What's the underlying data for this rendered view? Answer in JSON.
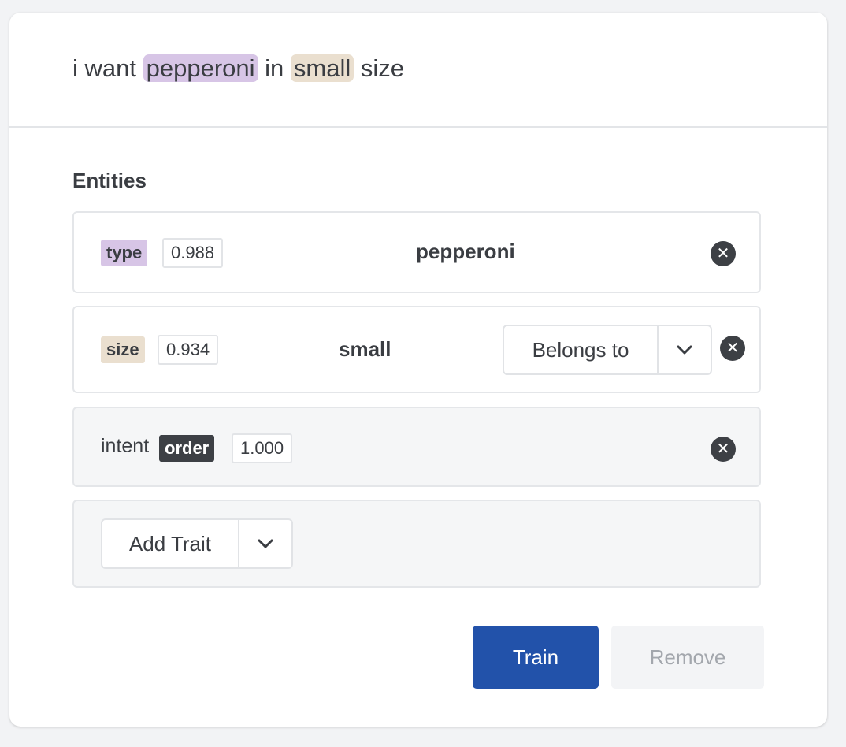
{
  "utterance": {
    "parts": [
      "i want ",
      "pepperoni",
      " in ",
      "small",
      " size"
    ]
  },
  "section_title": "Entities",
  "entities": [
    {
      "tag": "type",
      "confidence": "0.988",
      "value": "pepperoni"
    },
    {
      "tag": "size",
      "confidence": "0.934",
      "value": "small",
      "relation_label": "Belongs to"
    }
  ],
  "intent": {
    "label": "intent",
    "tag": "order",
    "confidence": "1.000"
  },
  "add_trait_label": "Add Trait",
  "buttons": {
    "train": "Train",
    "remove": "Remove"
  },
  "colors": {
    "type_tag": "#d7c5e6",
    "size_tag": "#eadfcf",
    "intent_tag": "#3d4045",
    "train_button": "#2252aa",
    "remove_button": "#f3f4f6"
  },
  "icons": {
    "remove_entity": "close-icon",
    "dropdown": "chevron-down-icon"
  }
}
